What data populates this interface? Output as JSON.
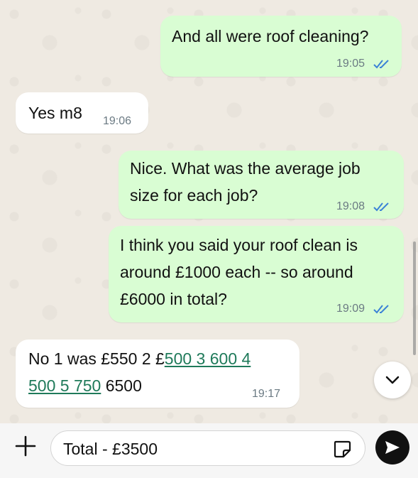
{
  "messages": [
    {
      "direction": "outgoing",
      "lines": [
        "And all were roof cleaning?"
      ],
      "time": "19:05",
      "status": "read"
    },
    {
      "direction": "incoming",
      "lines": [
        "Yes m8"
      ],
      "time": "19:06"
    },
    {
      "direction": "outgoing",
      "lines": [
        "Nice. What was the average job",
        "size for each job?"
      ],
      "time": "19:08",
      "status": "read"
    },
    {
      "direction": "outgoing",
      "lines": [
        "I think you said your roof clean is",
        "around £1000 each -- so around",
        "£6000 in total?"
      ],
      "time": "19:09",
      "status": "read"
    },
    {
      "direction": "incoming",
      "line1_plain": "No 1 was £550 2 £",
      "line1_link": "500 3 600 4",
      "line2_link": "500 5 750",
      "line2_plain": " 6500",
      "time": "19:17"
    }
  ],
  "composer": {
    "input_value": "Total - £3500"
  },
  "icons": {
    "plus": "plus-icon",
    "sticker": "sticker-icon",
    "send": "send-icon",
    "scroll_down": "chevron-down-icon",
    "read_ticks": "double-check-icon"
  },
  "colors": {
    "outgoing_bubble": "#d9fdd3",
    "incoming_bubble": "#ffffff",
    "chat_background": "#efeae2",
    "read_tick": "#3b82d6",
    "link": "#1f7a5a"
  }
}
